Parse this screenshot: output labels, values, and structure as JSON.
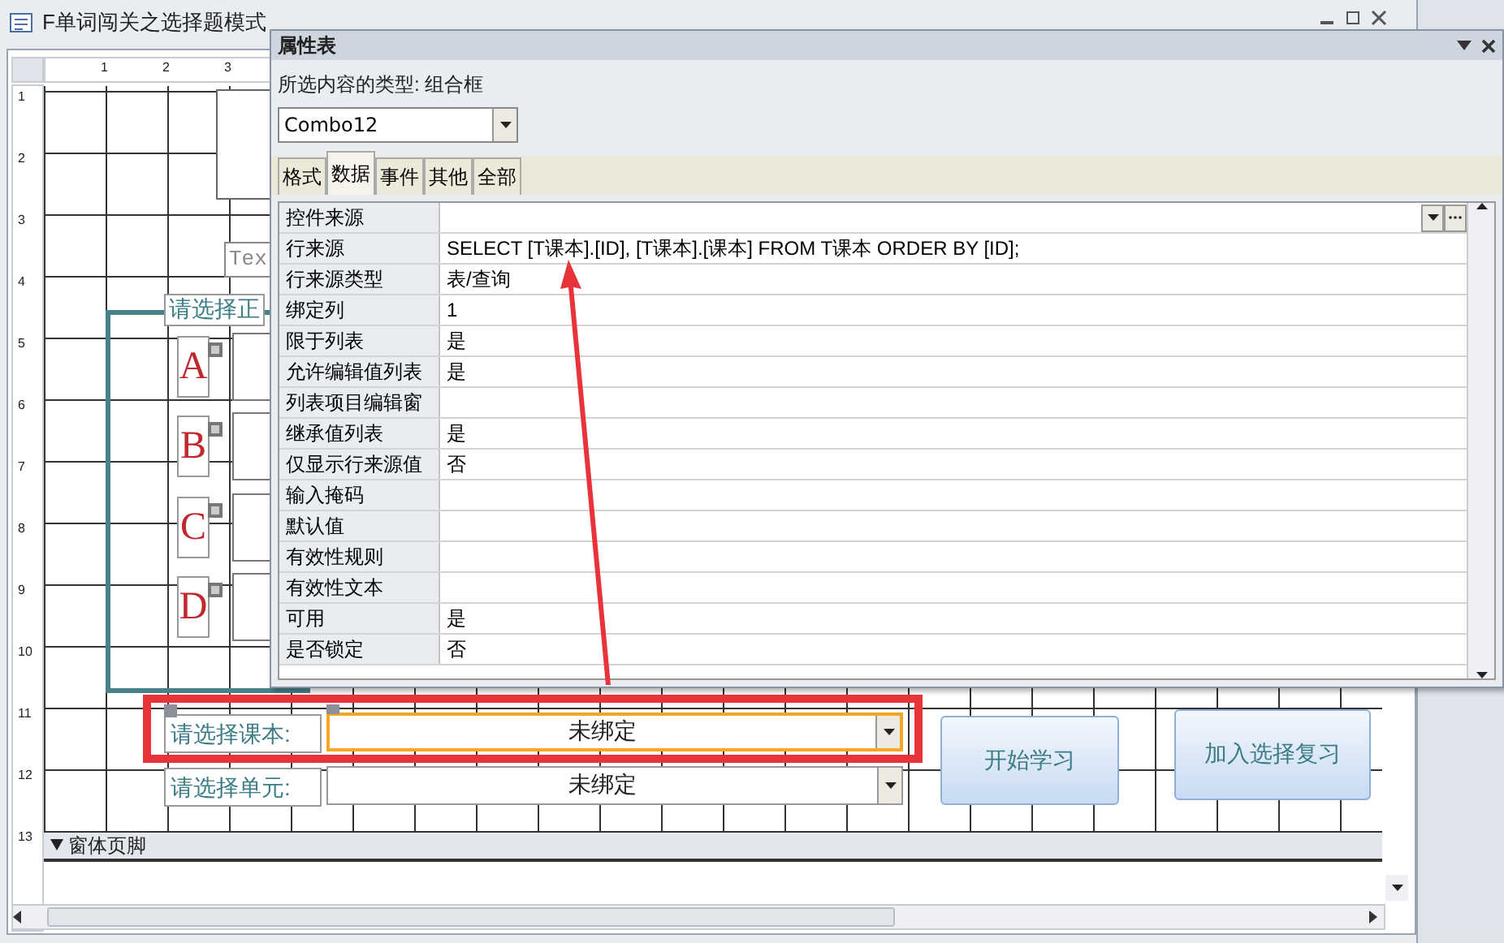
{
  "window": {
    "title": "F单词闯关之选择题模式"
  },
  "ruler": {
    "horizontal": [
      "1",
      "2",
      "3"
    ],
    "vertical": [
      "1",
      "2",
      "3",
      "4",
      "5",
      "6",
      "7",
      "8",
      "9",
      "10",
      "11",
      "12",
      "13"
    ]
  },
  "design": {
    "text_box": "Tex",
    "group_label": "请选择正",
    "options": [
      {
        "letter": "A"
      },
      {
        "letter": "B"
      },
      {
        "letter": "C"
      },
      {
        "letter": "D"
      }
    ],
    "fields": [
      {
        "label": "请选择课本:",
        "value": "未绑定",
        "selected": true
      },
      {
        "label": "请选择单元:",
        "value": "未绑定",
        "selected": false
      }
    ],
    "buttons": [
      "开始学习",
      "加入选择复习"
    ],
    "footer_section": "窗体页脚"
  },
  "property_sheet": {
    "title": "属性表",
    "selection_type": "所选内容的类型: 组合框",
    "object": "Combo12",
    "tabs": [
      {
        "label": "格式",
        "selected": false
      },
      {
        "label": "数据",
        "selected": true
      },
      {
        "label": "事件",
        "selected": false
      },
      {
        "label": "其他",
        "selected": false
      },
      {
        "label": "全部",
        "selected": false
      }
    ],
    "properties": [
      {
        "name": "控件来源",
        "focused": true
      },
      {
        "name": "行来源",
        "value": "SELECT [T课本].[ID], [T课本].[课本] FROM T课本 ORDER BY [ID];",
        "focused": false
      },
      {
        "name": "行来源类型",
        "value": "表/查询",
        "focused": false
      },
      {
        "name": "绑定列",
        "value": "1",
        "focused": false
      },
      {
        "name": "限于列表",
        "value": "是",
        "focused": false
      },
      {
        "name": "允许编辑值列表",
        "value": "是",
        "focused": false
      },
      {
        "name": "列表项目编辑窗",
        "focused": false
      },
      {
        "name": "继承值列表",
        "value": "是",
        "focused": false
      },
      {
        "name": "仅显示行来源值",
        "value": "否",
        "focused": false
      },
      {
        "name": "输入掩码",
        "focused": false
      },
      {
        "name": "默认值",
        "focused": false
      },
      {
        "name": "有效性规则",
        "focused": false
      },
      {
        "name": "有效性文本",
        "focused": false
      },
      {
        "name": "可用",
        "value": "是",
        "focused": false
      },
      {
        "name": "是否锁定",
        "value": "否",
        "focused": false
      }
    ]
  }
}
